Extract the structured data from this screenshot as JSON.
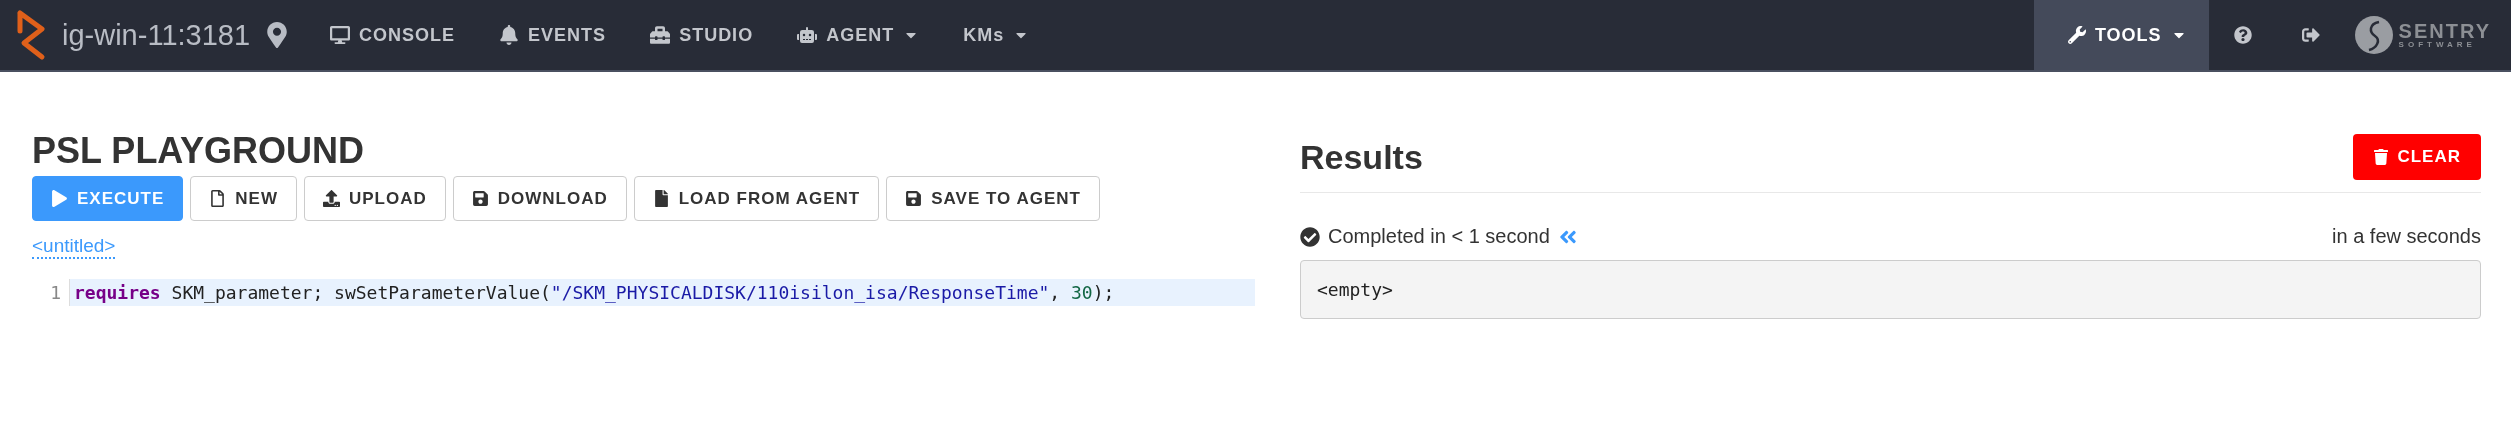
{
  "navbar": {
    "host": "ig-win-11:3181",
    "items": [
      {
        "label": "CONSOLE",
        "dropdown": false
      },
      {
        "label": "EVENTS",
        "dropdown": false
      },
      {
        "label": "STUDIO",
        "dropdown": false
      },
      {
        "label": "AGENT",
        "dropdown": true
      },
      {
        "label": "KMs",
        "dropdown": true
      }
    ],
    "tools": {
      "label": "TOOLS",
      "dropdown": true,
      "selected": true
    },
    "logo": {
      "name": "SENTRY",
      "tagline": "SOFTWARE"
    }
  },
  "playground": {
    "title": "PSL PLAYGROUND",
    "buttons": [
      {
        "label": "EXECUTE",
        "primary": true
      },
      {
        "label": "NEW",
        "primary": false
      },
      {
        "label": "UPLOAD",
        "primary": false
      },
      {
        "label": "DOWNLOAD",
        "primary": false
      },
      {
        "label": "LOAD FROM AGENT",
        "primary": false
      },
      {
        "label": "SAVE TO AGENT",
        "primary": false
      }
    ],
    "file_name": "<untitled>",
    "editor": {
      "lines": [
        {
          "number": "1",
          "highlighted": true,
          "tokens": [
            {
              "kind": "keyword",
              "text": "requires"
            },
            {
              "kind": "plain",
              "text": " SKM_parameter; swSetParameterValue("
            },
            {
              "kind": "string",
              "text": "\"/SKM_PHYSICALDISK/110isilon_isa/ResponseTime\""
            },
            {
              "kind": "plain",
              "text": ", "
            },
            {
              "kind": "number",
              "text": "30"
            },
            {
              "kind": "plain",
              "text": ");"
            }
          ]
        }
      ]
    }
  },
  "results": {
    "title": "Results",
    "clear_button": "CLEAR",
    "status": "Completed in < 1 second",
    "time": "in a few seconds",
    "output": "<empty>"
  }
}
